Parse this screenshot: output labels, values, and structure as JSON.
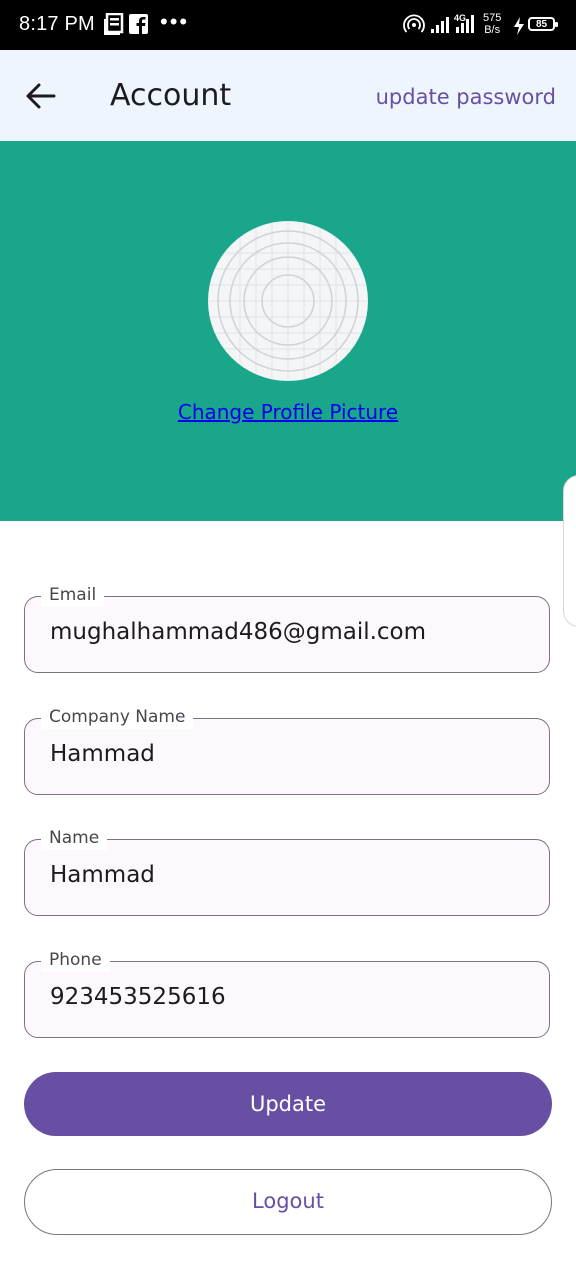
{
  "status_bar": {
    "time": "8:17 PM",
    "dots": "•••",
    "net_speed_value": "575",
    "net_speed_unit": "B/s",
    "battery": "85",
    "icons": [
      "news-icon",
      "facebook-icon",
      "hotspot-icon",
      "signal-icon",
      "4g-signal-icon",
      "charging-icon",
      "battery-icon"
    ]
  },
  "appbar": {
    "back_icon": "arrow-left-icon",
    "title": "Account",
    "update_password": "update password"
  },
  "profile": {
    "avatar_icon": "placeholder-avatar-icon",
    "change_picture": "Change Profile Picture"
  },
  "form": {
    "email": {
      "label": "Email",
      "value": "mughalhammad486@gmail.com"
    },
    "company": {
      "label": "Company Name",
      "value": "Hammad"
    },
    "name": {
      "label": "Name",
      "value": "Hammad"
    },
    "phone": {
      "label": "Phone",
      "value": "923453525616"
    }
  },
  "buttons": {
    "update": "Update",
    "logout": "Logout"
  },
  "colors": {
    "header_band": "#19a68a",
    "appbar": "#eef5fc",
    "primary": "#6750a4",
    "link": "#0000ee"
  }
}
